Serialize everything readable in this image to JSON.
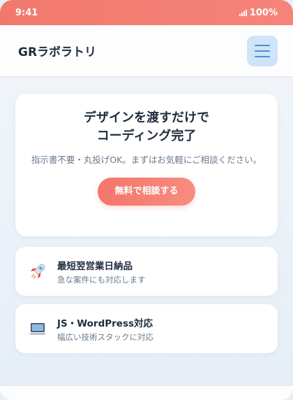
{
  "status": {
    "time": "9:41",
    "battery": "100%"
  },
  "header": {
    "logo": "GRラボラトリ"
  },
  "hero": {
    "title_line1": "デザインを渡すだけで",
    "title_line2": "コーディング完了",
    "desc": "指示書不要・丸投げOK。まずはお気軽にご相談ください。",
    "cta": "無料で相談する"
  },
  "features": [
    {
      "icon": "rocket-icon",
      "title": "最短翌営業日納品",
      "sub": "急な案件にも対応します"
    },
    {
      "icon": "laptop-icon",
      "title": "JS・WordPress対応",
      "sub": "幅広い技術スタックに対応"
    }
  ],
  "colors": {
    "accent": "#f3766a",
    "menu_bg": "#cfe4f8",
    "text": "#1f2d3d"
  }
}
